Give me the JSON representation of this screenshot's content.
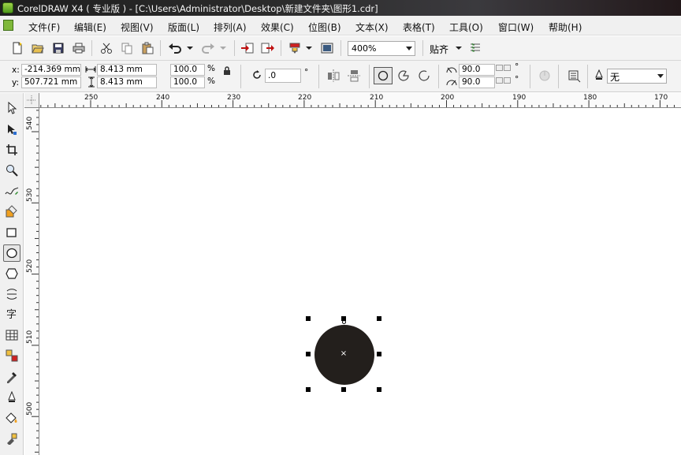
{
  "window": {
    "title": "CorelDRAW X4 ( 专业版 ) - [C:\\Users\\Administrator\\Desktop\\新建文件夹\\图形1.cdr]"
  },
  "menu": [
    "文件(F)",
    "编辑(E)",
    "视图(V)",
    "版面(L)",
    "排列(A)",
    "效果(C)",
    "位图(B)",
    "文本(X)",
    "表格(T)",
    "工具(O)",
    "窗口(W)",
    "帮助(H)"
  ],
  "toolbar": {
    "zoom_value": "400%",
    "snap_label": "贴齐"
  },
  "propbar": {
    "x_label": "x:",
    "x_value": "-214.369 mm",
    "y_label": "y:",
    "y_value": "507.721 mm",
    "width_value": "8.413 mm",
    "height_value": "8.413 mm",
    "scale_x": "100.0",
    "scale_y": "100.0",
    "percent": "%",
    "rotation": ".0",
    "degree": "°",
    "start_angle": "90.0",
    "end_angle": "90.0",
    "outline_width": "无"
  },
  "ruler_top_labels": [
    "250",
    "240",
    "230",
    "220",
    "210",
    "200",
    "190",
    "180",
    "170"
  ],
  "ruler_left_labels": [
    "540",
    "530",
    "520",
    "510",
    "500"
  ],
  "colors": {
    "ellipse_fill": "#231f1c",
    "selection_handle": "#000000"
  },
  "icons": {
    "toolbox": [
      "pick-tool-icon",
      "shape-tool-icon",
      "crop-tool-icon",
      "zoom-tool-icon",
      "freehand-tool-icon",
      "smart-fill-tool-icon",
      "rectangle-tool-icon",
      "ellipse-tool-icon",
      "polygon-tool-icon",
      "basic-shapes-tool-icon",
      "text-tool-icon",
      "table-tool-icon",
      "interactive-blend-tool-icon",
      "eyedropper-tool-icon",
      "outline-tool-icon",
      "fill-tool-icon",
      "interactive-fill-tool-icon"
    ]
  }
}
